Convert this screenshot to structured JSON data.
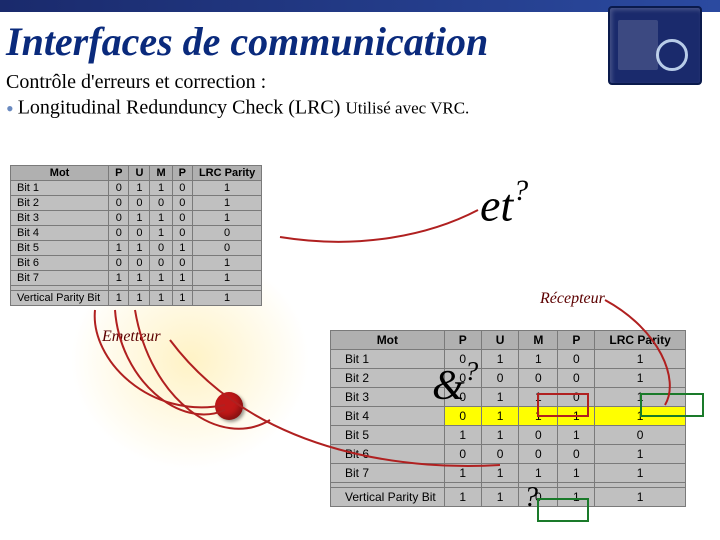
{
  "title": "Interfaces de communication",
  "subtitle1": "Contrôle d'erreurs et correction :",
  "subtitle2_main": "Longitudinal Redunduncy Check (LRC)",
  "subtitle2_note": "Utilisé avec VRC.",
  "labels": {
    "emetteur": "Emetteur",
    "recepteur": "Récepteur"
  },
  "annotations": {
    "q1_left": "et",
    "q1_right": "?",
    "q2_left": "&",
    "q2_right": "?",
    "q3": "?"
  },
  "table_headers": [
    "Mot",
    "P",
    "U",
    "M",
    "P",
    "LRC Parity"
  ],
  "table1": {
    "rows": [
      [
        "Bit 1",
        "0",
        "1",
        "1",
        "0",
        "1"
      ],
      [
        "Bit 2",
        "0",
        "0",
        "0",
        "0",
        "1"
      ],
      [
        "Bit 3",
        "0",
        "1",
        "1",
        "0",
        "1"
      ],
      [
        "Bit 4",
        "0",
        "0",
        "1",
        "0",
        "0"
      ],
      [
        "Bit 5",
        "1",
        "1",
        "0",
        "1",
        "0"
      ],
      [
        "Bit 6",
        "0",
        "0",
        "0",
        "0",
        "1"
      ],
      [
        "Bit 7",
        "1",
        "1",
        "1",
        "1",
        "1"
      ]
    ],
    "parity_label": "Vertical Parity Bit",
    "parity": [
      "1",
      "1",
      "1",
      "1",
      "1"
    ]
  },
  "table2": {
    "rows": [
      [
        "Bit 1",
        "0",
        "1",
        "1",
        "0",
        "1"
      ],
      [
        "Bit 2",
        "0",
        "0",
        "0",
        "0",
        "1"
      ],
      [
        "Bit 3",
        "0",
        "1",
        "1",
        "0",
        "1"
      ],
      [
        "Bit 4",
        "0",
        "1",
        "1",
        "1",
        "1"
      ],
      [
        "Bit 5",
        "1",
        "1",
        "0",
        "1",
        "0"
      ],
      [
        "Bit 6",
        "0",
        "0",
        "0",
        "0",
        "1"
      ],
      [
        "Bit 7",
        "1",
        "1",
        "1",
        "1",
        "1"
      ]
    ],
    "highlight_row_index": 3,
    "parity_label": "Vertical Parity Bit",
    "parity": [
      "1",
      "1",
      "0",
      "1",
      "1"
    ]
  }
}
